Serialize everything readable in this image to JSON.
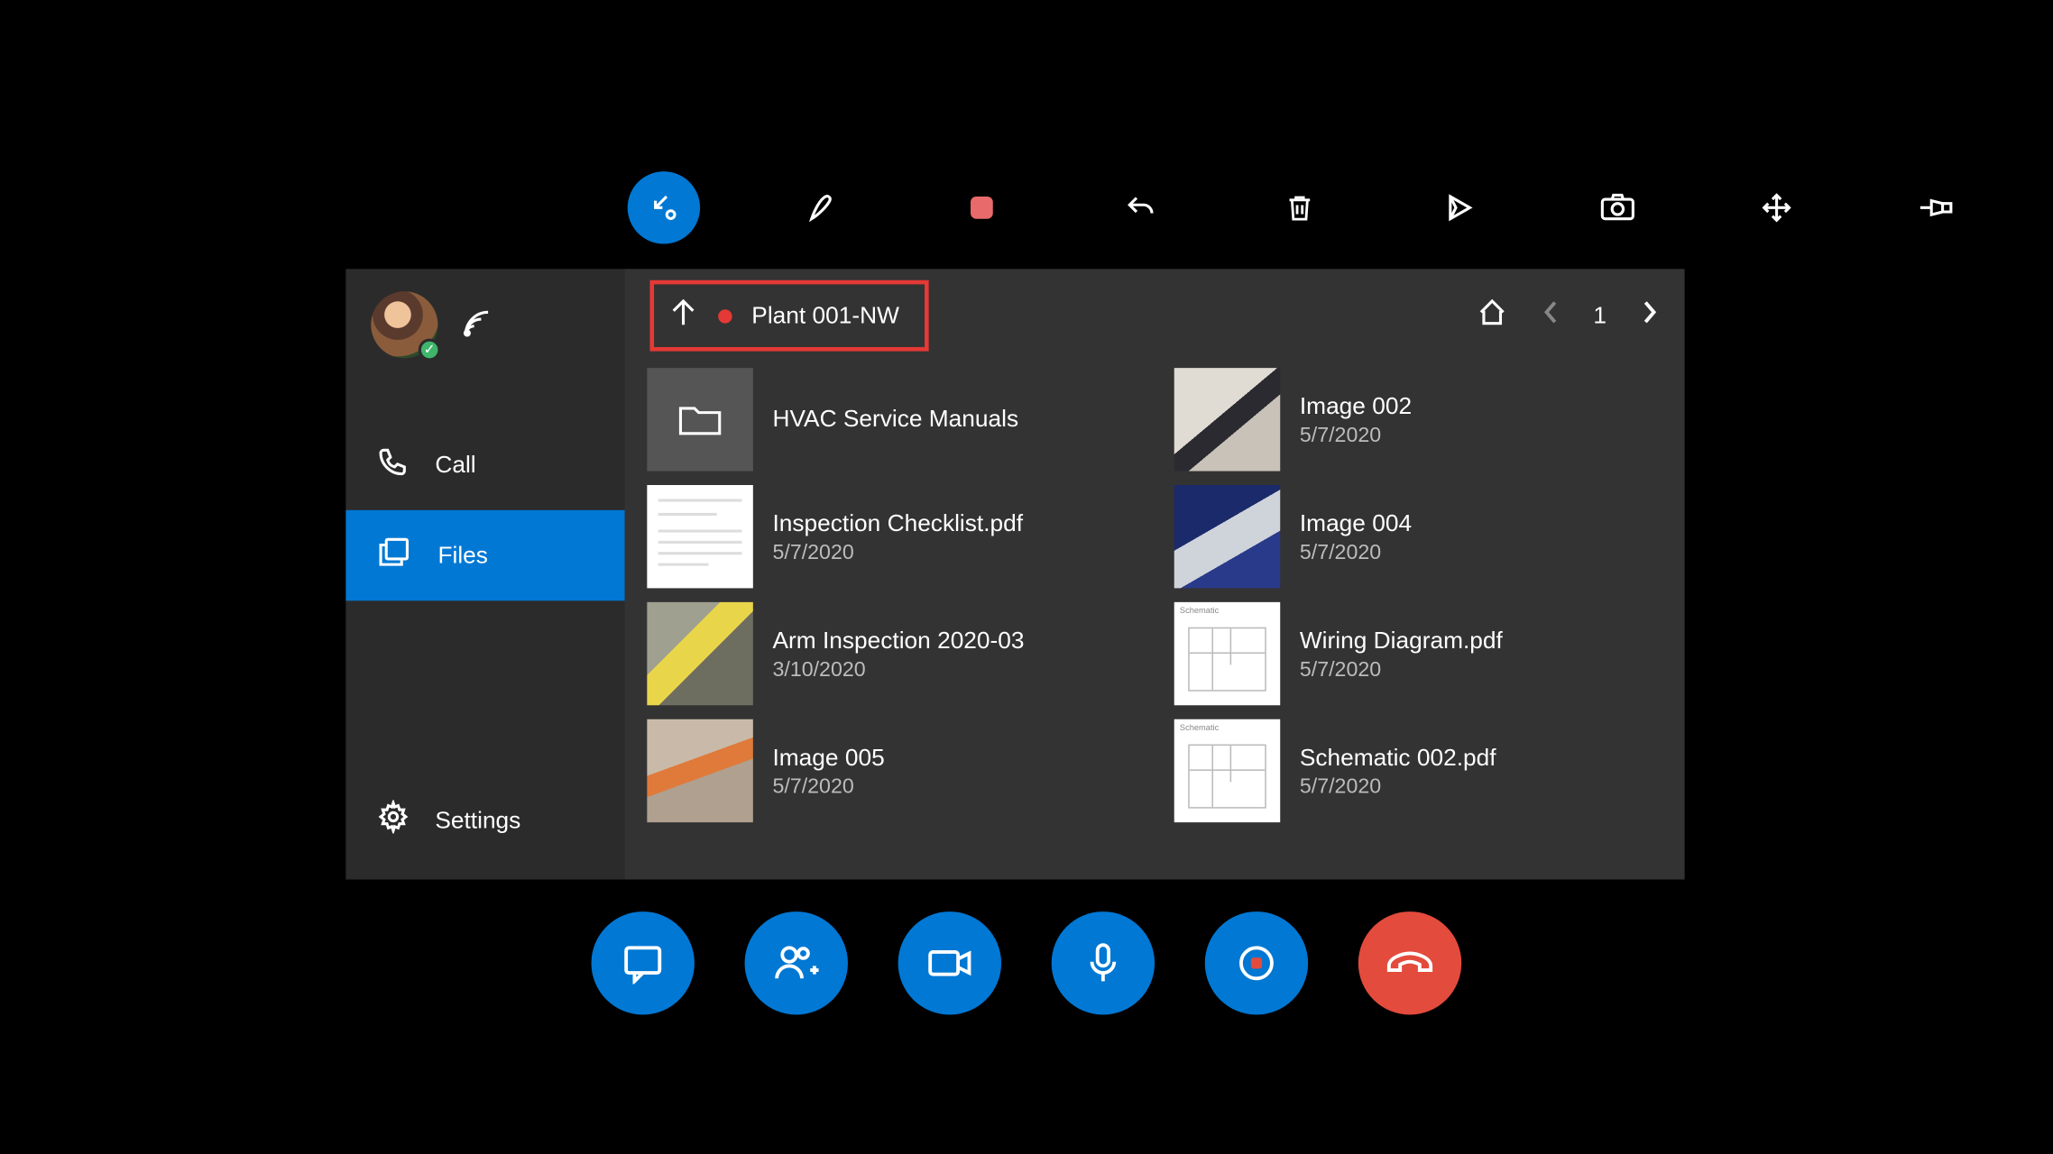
{
  "sidebar": {
    "items": [
      {
        "icon": "phone",
        "label": "Call"
      },
      {
        "icon": "files",
        "label": "Files"
      },
      {
        "icon": "gear",
        "label": "Settings"
      }
    ],
    "active_index": 1
  },
  "breadcrumb": {
    "label": "Plant 001-NW"
  },
  "pager": {
    "page": "1"
  },
  "files": {
    "left": [
      {
        "name": "HVAC Service Manuals",
        "date": "",
        "thumb": "folder"
      },
      {
        "name": "Inspection Checklist.pdf",
        "date": "5/7/2020",
        "thumb": "doc"
      },
      {
        "name": "Arm Inspection 2020-03",
        "date": "3/10/2020",
        "thumb": "photo2"
      },
      {
        "name": "Image 005",
        "date": "5/7/2020",
        "thumb": "photo3"
      }
    ],
    "right": [
      {
        "name": "Image 002",
        "date": "5/7/2020",
        "thumb": "photo4"
      },
      {
        "name": "Image 004",
        "date": "5/7/2020",
        "thumb": "photo5"
      },
      {
        "name": "Wiring Diagram.pdf",
        "date": "5/7/2020",
        "thumb": "schematic"
      },
      {
        "name": "Schematic 002.pdf",
        "date": "5/7/2020",
        "thumb": "schematic"
      }
    ]
  },
  "top_tools": [
    "arrow-collapse",
    "pen",
    "stop",
    "undo",
    "trash",
    "play",
    "camera",
    "move",
    "pin"
  ],
  "call_bar": [
    "chat",
    "add-people",
    "video",
    "mic",
    "ink-dot",
    "hangup"
  ]
}
